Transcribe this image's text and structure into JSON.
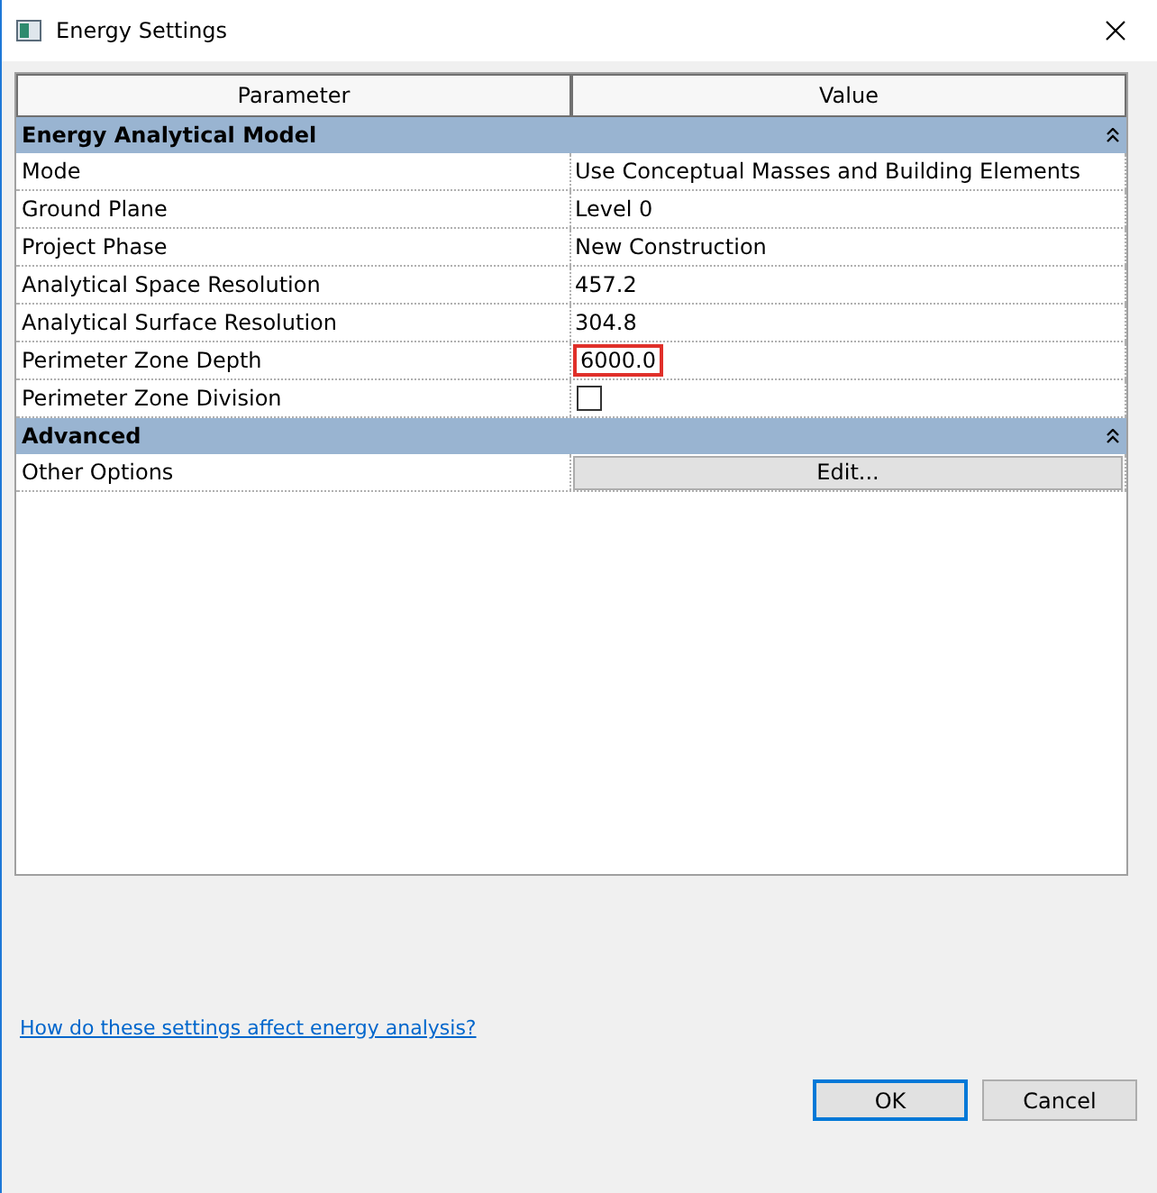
{
  "window": {
    "title": "Energy Settings"
  },
  "table": {
    "columns": [
      "Parameter",
      "Value"
    ],
    "groups": [
      {
        "title": "Energy Analytical Model",
        "expanded": true,
        "rows": [
          {
            "name": "Mode",
            "kind": "text",
            "value": "Use Conceptual Masses and Building Elements"
          },
          {
            "name": "Ground Plane",
            "kind": "text",
            "value": "Level 0"
          },
          {
            "name": "Project Phase",
            "kind": "text",
            "value": "New Construction"
          },
          {
            "name": "Analytical Space Resolution",
            "kind": "text",
            "value": "457.2"
          },
          {
            "name": "Analytical Surface Resolution",
            "kind": "text",
            "value": "304.8"
          },
          {
            "name": "Perimeter Zone Depth",
            "kind": "input",
            "value": "6000.0",
            "focused": true
          },
          {
            "name": "Perimeter Zone Division",
            "kind": "checkbox",
            "checked": false
          }
        ]
      },
      {
        "title": "Advanced",
        "expanded": true,
        "rows": [
          {
            "name": "Other Options",
            "kind": "button",
            "value": "Edit..."
          }
        ]
      }
    ]
  },
  "help_link": "How do these settings affect energy analysis?",
  "buttons": [
    {
      "label": "OK",
      "default": true
    },
    {
      "label": "Cancel",
      "default": false
    }
  ]
}
